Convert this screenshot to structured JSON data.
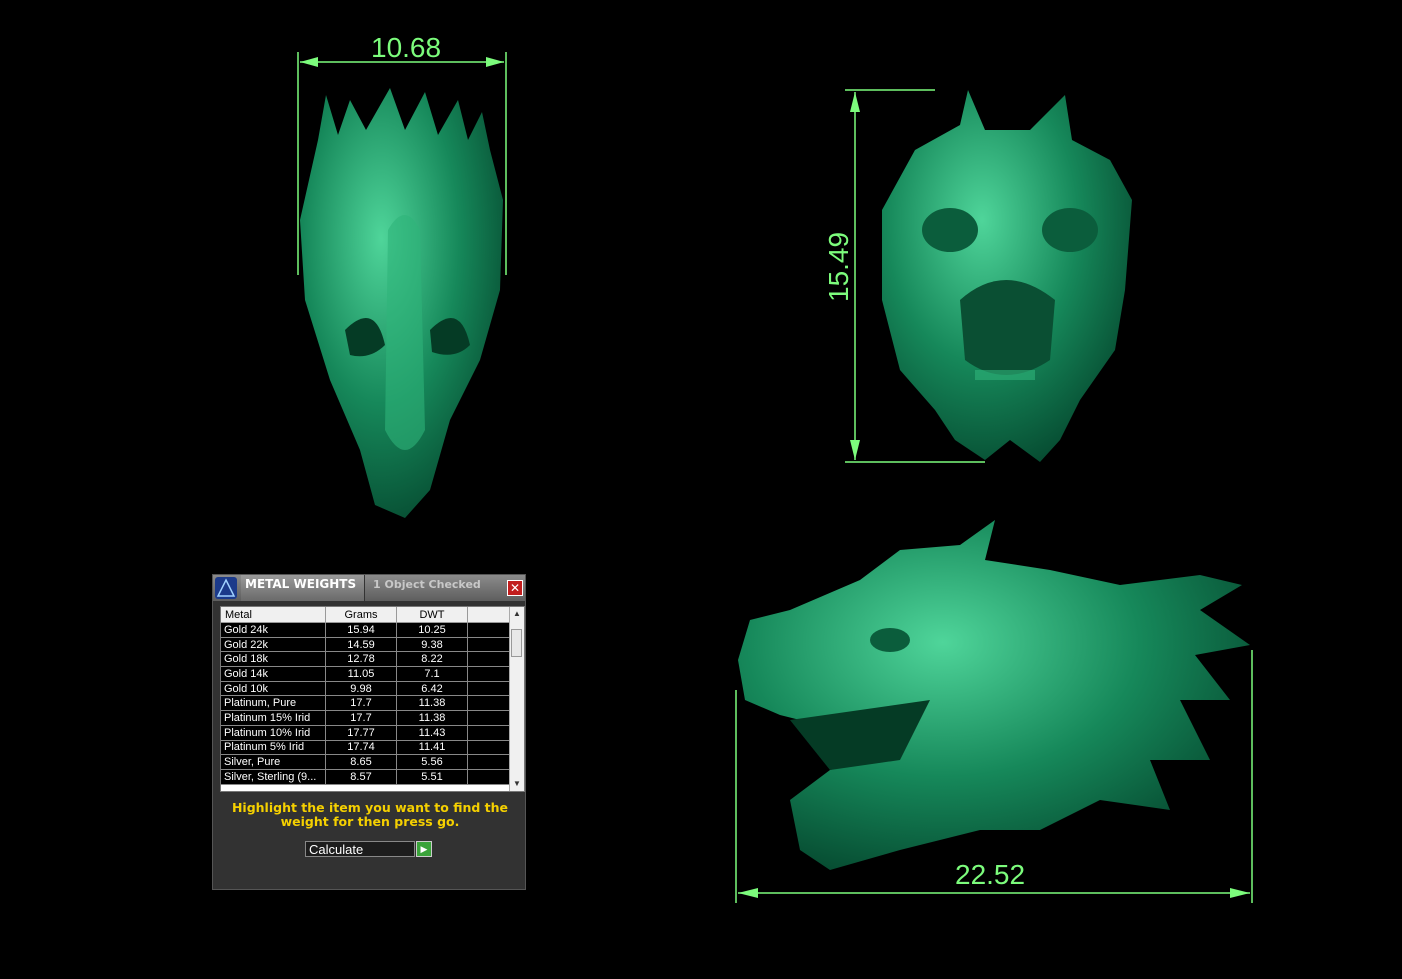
{
  "colors": {
    "background": "#000000",
    "dimension": "#7CFC7C",
    "model": "#1a8a5a",
    "accent_yellow": "#f5d000"
  },
  "dimensions": {
    "top_width": "10.68",
    "front_height": "15.49",
    "side_length": "22.52"
  },
  "dialog": {
    "logo_icon": "matrix-logo-icon",
    "title": "METAL WEIGHTS",
    "status": "1 Object Checked",
    "close_icon": "close-icon",
    "columns": [
      "Metal",
      "Grams",
      "DWT"
    ],
    "rows": [
      [
        "Gold 24k",
        "15.94",
        "10.25"
      ],
      [
        "Gold 22k",
        "14.59",
        "9.38"
      ],
      [
        "Gold 18k",
        "12.78",
        "8.22"
      ],
      [
        "Gold 14k",
        "11.05",
        "7.1"
      ],
      [
        "Gold 10k",
        "9.98",
        "6.42"
      ],
      [
        "Platinum, Pure",
        "17.7",
        "11.38"
      ],
      [
        "Platinum 15% Irid",
        "17.7",
        "11.38"
      ],
      [
        "Platinum 10% Irid",
        "17.77",
        "11.43"
      ],
      [
        "Platinum 5% Irid",
        "17.74",
        "11.41"
      ],
      [
        "Silver, Pure",
        "8.65",
        "5.56"
      ],
      [
        "Silver, Sterling (9...",
        "8.57",
        "5.51"
      ]
    ],
    "message": "Highlight the item you want to find the weight for then press go.",
    "select_value": "Calculate",
    "go_icon": "play-arrow-icon"
  }
}
